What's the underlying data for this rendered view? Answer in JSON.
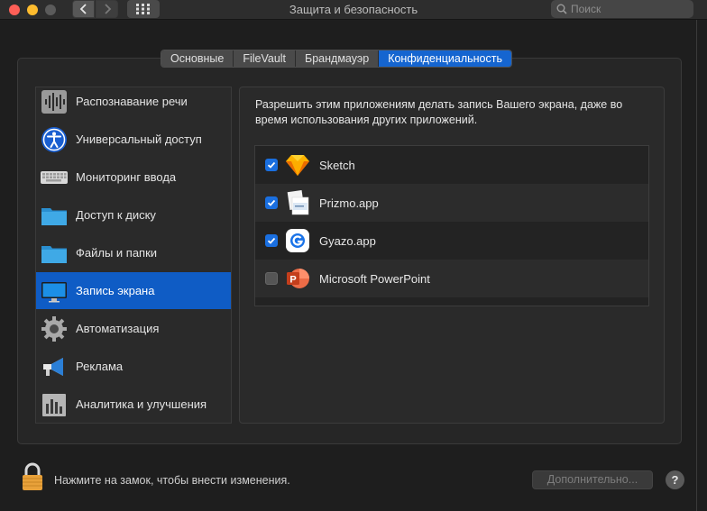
{
  "window": {
    "title": "Защита и безопасность",
    "search_placeholder": "Поиск"
  },
  "tabs": [
    {
      "label": "Основные",
      "active": false
    },
    {
      "label": "FileVault",
      "active": false
    },
    {
      "label": "Брандмауэр",
      "active": false
    },
    {
      "label": "Конфиденциальность",
      "active": true
    }
  ],
  "sidebar": {
    "items": [
      {
        "label": "Распознавание речи",
        "icon": "speech-waveform-icon"
      },
      {
        "label": "Универсальный доступ",
        "icon": "accessibility-icon"
      },
      {
        "label": "Мониторинг ввода",
        "icon": "keyboard-icon"
      },
      {
        "label": "Доступ к диску",
        "icon": "folder-icon"
      },
      {
        "label": "Файлы и папки",
        "icon": "folder-icon"
      },
      {
        "label": "Запись экрана",
        "icon": "display-icon",
        "selected": true
      },
      {
        "label": "Автоматизация",
        "icon": "gear-icon"
      },
      {
        "label": "Реклама",
        "icon": "megaphone-icon"
      },
      {
        "label": "Аналитика и улучшения",
        "icon": "bar-chart-icon"
      }
    ]
  },
  "main": {
    "description": "Разрешить этим приложениям делать запись Вашего экрана, даже во время использования других приложений.",
    "apps": [
      {
        "name": "Sketch",
        "checked": true,
        "icon": "sketch-diamond-icon"
      },
      {
        "name": "Prizmo.app",
        "checked": true,
        "icon": "prizmo-icon"
      },
      {
        "name": "Gyazo.app",
        "checked": true,
        "icon": "gyazo-icon"
      },
      {
        "name": "Microsoft PowerPoint",
        "checked": false,
        "icon": "powerpoint-icon"
      }
    ]
  },
  "footer": {
    "lock_text": "Нажмите на замок, чтобы внести изменения.",
    "advanced_label": "Дополнительно...",
    "help_label": "?"
  },
  "colors": {
    "accent": "#1565d0",
    "selection": "#0f5cc5",
    "checkbox_on": "#1a6fe0"
  }
}
